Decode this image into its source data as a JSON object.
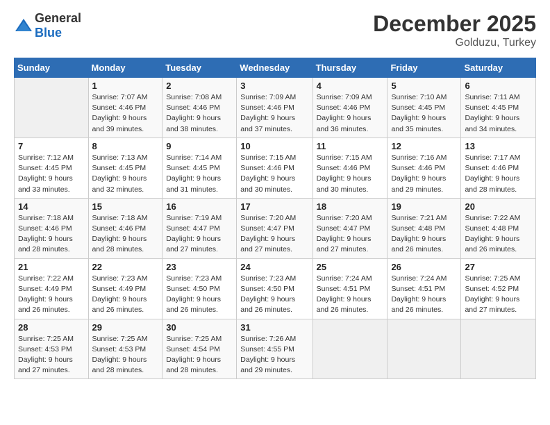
{
  "header": {
    "logo_general": "General",
    "logo_blue": "Blue",
    "month": "December 2025",
    "location": "Golduzu, Turkey"
  },
  "days_of_week": [
    "Sunday",
    "Monday",
    "Tuesday",
    "Wednesday",
    "Thursday",
    "Friday",
    "Saturday"
  ],
  "weeks": [
    [
      {
        "day": "",
        "sunrise": "",
        "sunset": "",
        "daylight": ""
      },
      {
        "day": "1",
        "sunrise": "Sunrise: 7:07 AM",
        "sunset": "Sunset: 4:46 PM",
        "daylight": "Daylight: 9 hours and 39 minutes."
      },
      {
        "day": "2",
        "sunrise": "Sunrise: 7:08 AM",
        "sunset": "Sunset: 4:46 PM",
        "daylight": "Daylight: 9 hours and 38 minutes."
      },
      {
        "day": "3",
        "sunrise": "Sunrise: 7:09 AM",
        "sunset": "Sunset: 4:46 PM",
        "daylight": "Daylight: 9 hours and 37 minutes."
      },
      {
        "day": "4",
        "sunrise": "Sunrise: 7:09 AM",
        "sunset": "Sunset: 4:46 PM",
        "daylight": "Daylight: 9 hours and 36 minutes."
      },
      {
        "day": "5",
        "sunrise": "Sunrise: 7:10 AM",
        "sunset": "Sunset: 4:45 PM",
        "daylight": "Daylight: 9 hours and 35 minutes."
      },
      {
        "day": "6",
        "sunrise": "Sunrise: 7:11 AM",
        "sunset": "Sunset: 4:45 PM",
        "daylight": "Daylight: 9 hours and 34 minutes."
      }
    ],
    [
      {
        "day": "7",
        "sunrise": "Sunrise: 7:12 AM",
        "sunset": "Sunset: 4:45 PM",
        "daylight": "Daylight: 9 hours and 33 minutes."
      },
      {
        "day": "8",
        "sunrise": "Sunrise: 7:13 AM",
        "sunset": "Sunset: 4:45 PM",
        "daylight": "Daylight: 9 hours and 32 minutes."
      },
      {
        "day": "9",
        "sunrise": "Sunrise: 7:14 AM",
        "sunset": "Sunset: 4:45 PM",
        "daylight": "Daylight: 9 hours and 31 minutes."
      },
      {
        "day": "10",
        "sunrise": "Sunrise: 7:15 AM",
        "sunset": "Sunset: 4:46 PM",
        "daylight": "Daylight: 9 hours and 30 minutes."
      },
      {
        "day": "11",
        "sunrise": "Sunrise: 7:15 AM",
        "sunset": "Sunset: 4:46 PM",
        "daylight": "Daylight: 9 hours and 30 minutes."
      },
      {
        "day": "12",
        "sunrise": "Sunrise: 7:16 AM",
        "sunset": "Sunset: 4:46 PM",
        "daylight": "Daylight: 9 hours and 29 minutes."
      },
      {
        "day": "13",
        "sunrise": "Sunrise: 7:17 AM",
        "sunset": "Sunset: 4:46 PM",
        "daylight": "Daylight: 9 hours and 28 minutes."
      }
    ],
    [
      {
        "day": "14",
        "sunrise": "Sunrise: 7:18 AM",
        "sunset": "Sunset: 4:46 PM",
        "daylight": "Daylight: 9 hours and 28 minutes."
      },
      {
        "day": "15",
        "sunrise": "Sunrise: 7:18 AM",
        "sunset": "Sunset: 4:46 PM",
        "daylight": "Daylight: 9 hours and 28 minutes."
      },
      {
        "day": "16",
        "sunrise": "Sunrise: 7:19 AM",
        "sunset": "Sunset: 4:47 PM",
        "daylight": "Daylight: 9 hours and 27 minutes."
      },
      {
        "day": "17",
        "sunrise": "Sunrise: 7:20 AM",
        "sunset": "Sunset: 4:47 PM",
        "daylight": "Daylight: 9 hours and 27 minutes."
      },
      {
        "day": "18",
        "sunrise": "Sunrise: 7:20 AM",
        "sunset": "Sunset: 4:47 PM",
        "daylight": "Daylight: 9 hours and 27 minutes."
      },
      {
        "day": "19",
        "sunrise": "Sunrise: 7:21 AM",
        "sunset": "Sunset: 4:48 PM",
        "daylight": "Daylight: 9 hours and 26 minutes."
      },
      {
        "day": "20",
        "sunrise": "Sunrise: 7:22 AM",
        "sunset": "Sunset: 4:48 PM",
        "daylight": "Daylight: 9 hours and 26 minutes."
      }
    ],
    [
      {
        "day": "21",
        "sunrise": "Sunrise: 7:22 AM",
        "sunset": "Sunset: 4:49 PM",
        "daylight": "Daylight: 9 hours and 26 minutes."
      },
      {
        "day": "22",
        "sunrise": "Sunrise: 7:23 AM",
        "sunset": "Sunset: 4:49 PM",
        "daylight": "Daylight: 9 hours and 26 minutes."
      },
      {
        "day": "23",
        "sunrise": "Sunrise: 7:23 AM",
        "sunset": "Sunset: 4:50 PM",
        "daylight": "Daylight: 9 hours and 26 minutes."
      },
      {
        "day": "24",
        "sunrise": "Sunrise: 7:23 AM",
        "sunset": "Sunset: 4:50 PM",
        "daylight": "Daylight: 9 hours and 26 minutes."
      },
      {
        "day": "25",
        "sunrise": "Sunrise: 7:24 AM",
        "sunset": "Sunset: 4:51 PM",
        "daylight": "Daylight: 9 hours and 26 minutes."
      },
      {
        "day": "26",
        "sunrise": "Sunrise: 7:24 AM",
        "sunset": "Sunset: 4:51 PM",
        "daylight": "Daylight: 9 hours and 26 minutes."
      },
      {
        "day": "27",
        "sunrise": "Sunrise: 7:25 AM",
        "sunset": "Sunset: 4:52 PM",
        "daylight": "Daylight: 9 hours and 27 minutes."
      }
    ],
    [
      {
        "day": "28",
        "sunrise": "Sunrise: 7:25 AM",
        "sunset": "Sunset: 4:53 PM",
        "daylight": "Daylight: 9 hours and 27 minutes."
      },
      {
        "day": "29",
        "sunrise": "Sunrise: 7:25 AM",
        "sunset": "Sunset: 4:53 PM",
        "daylight": "Daylight: 9 hours and 28 minutes."
      },
      {
        "day": "30",
        "sunrise": "Sunrise: 7:25 AM",
        "sunset": "Sunset: 4:54 PM",
        "daylight": "Daylight: 9 hours and 28 minutes."
      },
      {
        "day": "31",
        "sunrise": "Sunrise: 7:26 AM",
        "sunset": "Sunset: 4:55 PM",
        "daylight": "Daylight: 9 hours and 29 minutes."
      },
      {
        "day": "",
        "sunrise": "",
        "sunset": "",
        "daylight": ""
      },
      {
        "day": "",
        "sunrise": "",
        "sunset": "",
        "daylight": ""
      },
      {
        "day": "",
        "sunrise": "",
        "sunset": "",
        "daylight": ""
      }
    ]
  ]
}
